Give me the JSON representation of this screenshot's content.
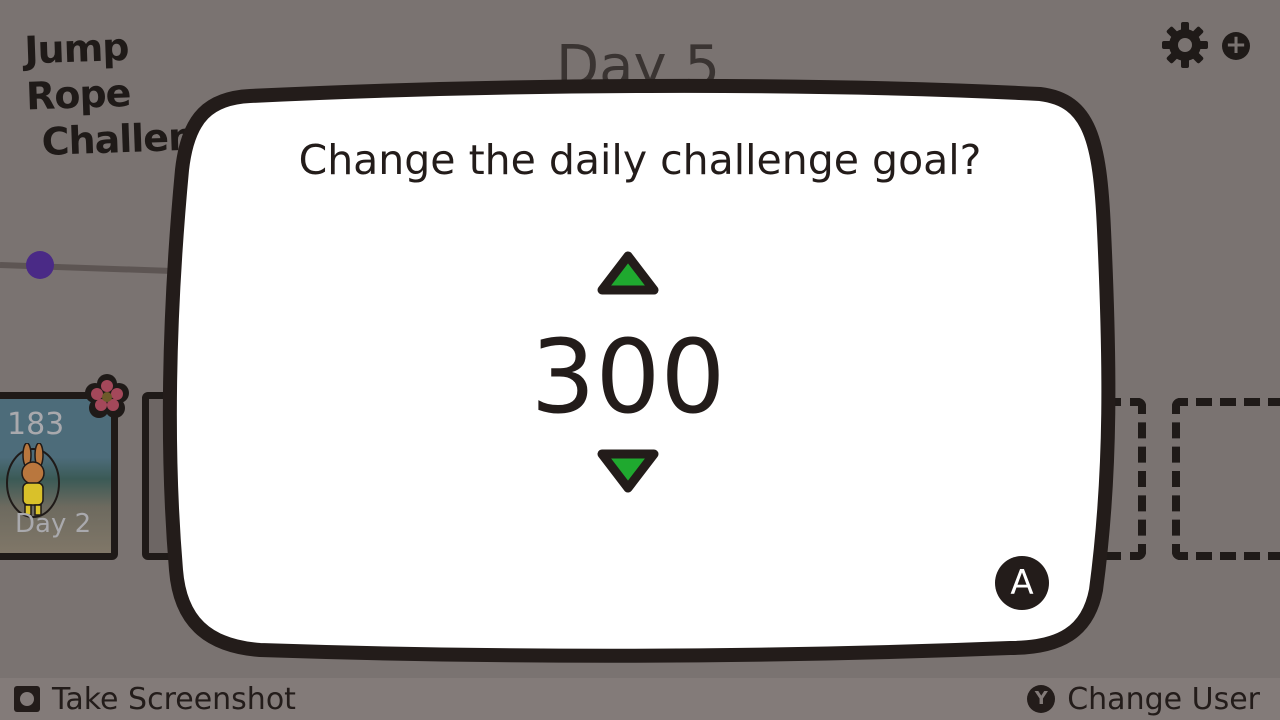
{
  "header": {
    "logo_line1": "Jump Rope",
    "logo_line2": "Challenge",
    "day_title": "Day 5"
  },
  "icons": {
    "settings": "gear-icon",
    "add_user": "plus-circle-icon"
  },
  "cards": [
    {
      "count": "183",
      "day": "Day 2"
    }
  ],
  "dialog": {
    "title": "Change the daily challenge goal?",
    "value": "300",
    "confirm_button": "A"
  },
  "footer": {
    "left_label": "Take Screenshot",
    "right_button": "Y",
    "right_label": "Change User"
  },
  "colors": {
    "background_dim": "#7a7371",
    "dialog_fill": "#ffffff",
    "outline": "#231c1a",
    "arrow_green": "#1fa92f",
    "track_dot": "#4a2a86"
  }
}
